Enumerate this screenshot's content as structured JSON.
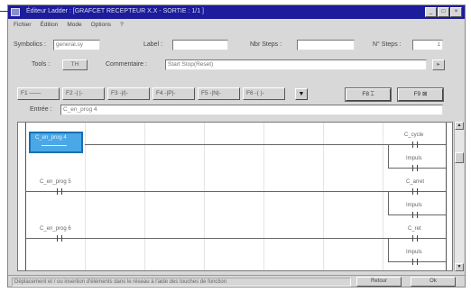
{
  "window": {
    "title": "Éditeur Ladder : [GRAFCET RECEPTEUR X.X - SORTIE : 1/1 ]",
    "controls": [
      "_",
      "□",
      "×"
    ]
  },
  "menu": [
    "Fichier",
    "Édition",
    "Mode",
    "Options",
    "?"
  ],
  "form": {
    "symbolics_label": "Symbolics :",
    "symbolics_value": "general.sy",
    "label_label": "Label :",
    "label_value": "",
    "nbr_steps_label": "Nbr Steps :",
    "nbr_steps_value": "",
    "n_steps_label": "N° Steps :",
    "n_steps_value": "1",
    "tools_label": "Tools :",
    "tools_value": "TH",
    "comment_label": "Commentaire :",
    "comment_value": "Start Stop(Reset)"
  },
  "fkeys": [
    "F2 -| |-",
    "F3 -|/|-",
    "F4 -|P|-",
    "F5 -|N|-",
    "F6 -( )-",
    "F7 -(/)-"
  ],
  "fkey_first": "F1 ——",
  "fbuttons": [
    "F8 ⌶",
    "F9 ⊠"
  ],
  "arrow_symbol": "▼",
  "entry": {
    "label": "Entrée :",
    "value": "C_en_prog 4"
  },
  "rungs": [
    {
      "contact": "C_en_prog 4",
      "coil_top": "C_cycle",
      "coil_bottom": "Impuls"
    },
    {
      "contact": "C_en_prog 5",
      "coil_top": "C_arret",
      "coil_bottom": "Impuls"
    },
    {
      "contact": "C_en_prog 6",
      "coil_top": "C_ret",
      "coil_bottom": "Impuls"
    }
  ],
  "status": {
    "text": "Déplacement et / ou insertion d'éléments dans le réseau à l'aide des touches de fonction",
    "btn1": "Retour",
    "btn2": "Ok"
  },
  "colors": {
    "titlebar": "#1c1c9c",
    "selection": "#4aa8e6"
  }
}
